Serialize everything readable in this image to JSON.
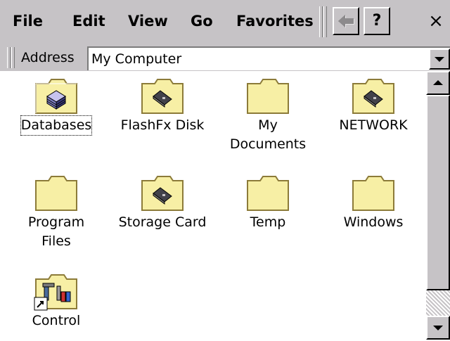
{
  "menu": {
    "items": [
      "File",
      "Edit",
      "View",
      "Go",
      "Favorites"
    ]
  },
  "toolbar": {
    "back_icon": "back-arrow-icon",
    "help_label": "?",
    "close_label": "×"
  },
  "address": {
    "label": "Address",
    "value": "My Computer"
  },
  "files": [
    {
      "label": "Databases",
      "icon": "database-folder-icon",
      "selected": true
    },
    {
      "label": "FlashFx Disk",
      "icon": "storage-card-folder-icon",
      "selected": false
    },
    {
      "label": "My\nDocuments",
      "icon": "folder-icon",
      "selected": false
    },
    {
      "label": "NETWORK",
      "icon": "storage-card-folder-icon",
      "selected": false
    },
    {
      "label": "Program\nFiles",
      "icon": "folder-icon",
      "selected": false
    },
    {
      "label": "Storage Card",
      "icon": "storage-card-folder-icon",
      "selected": false
    },
    {
      "label": "Temp",
      "icon": "folder-icon",
      "selected": false
    },
    {
      "label": "Windows",
      "icon": "folder-icon",
      "selected": false
    },
    {
      "label": "Control",
      "icon": "control-panel-shortcut-icon",
      "selected": false
    }
  ],
  "colors": {
    "chrome": "#c6c3c6",
    "folder_fill": "#f7efa5",
    "folder_stroke": "#8c7b39"
  }
}
